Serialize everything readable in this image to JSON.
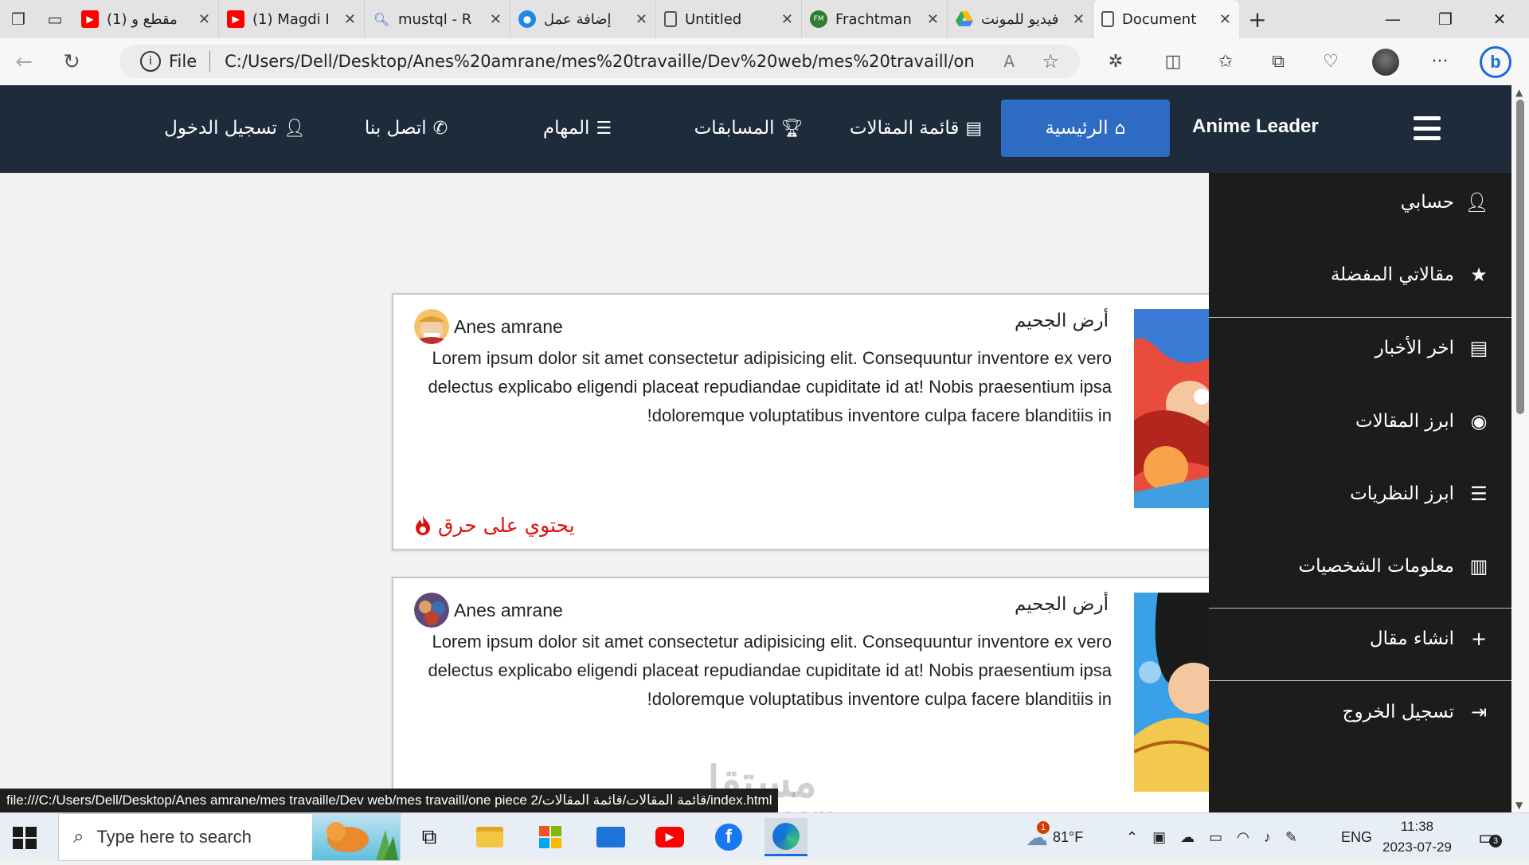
{
  "browser": {
    "tabs": [
      {
        "title": "(1) مقطع و",
        "favicon": "youtube-icon"
      },
      {
        "title": "(1) Magdi I",
        "favicon": "youtube-icon"
      },
      {
        "title": "mustql - R",
        "favicon": "search-icon"
      },
      {
        "title": "إضافة عمل",
        "favicon": "circle-icon"
      },
      {
        "title": "Untitled",
        "favicon": "page-icon"
      },
      {
        "title": "Frachtman",
        "favicon": "site-icon"
      },
      {
        "title": "فيديو للمونت",
        "favicon": "drive-icon"
      },
      {
        "title": "Document",
        "favicon": "page-icon",
        "active": true
      }
    ],
    "address_prefix": "File",
    "address": "C:/Users/Dell/Desktop/Anes%20amrane/mes%20travaille/Dev%20web/mes%20travaill/one%20piece..."
  },
  "navbar": {
    "brand": "Anime Leader",
    "items": [
      {
        "label": "الرئيسية",
        "icon": "home-icon",
        "active": true
      },
      {
        "label": "قائمة المقالات",
        "icon": "newspaper-icon"
      },
      {
        "label": "المسابقات",
        "icon": "trophy-icon"
      },
      {
        "label": "المهام",
        "icon": "tasks-icon"
      },
      {
        "label": "اتصل بنا",
        "icon": "phone-icon"
      },
      {
        "label": "تسجيل الدخول",
        "icon": "user-icon"
      }
    ]
  },
  "cards": [
    {
      "author": "Anes amrane",
      "title": "أرض الجحيم",
      "body": "Lorem ipsum dolor sit amet consectetur adipisicing elit. Consequuntur inventore ex vero delectus explicabo eligendi placeat repudiandae cupiditate id at! Nobis praesentium ipsa doloremque voluptatibus inventore culpa facere blanditiis in!",
      "warning": "يحتوي على حرق"
    },
    {
      "author": "Anes amrane",
      "title": "أرض الجحيم",
      "body": "Lorem ipsum dolor sit amet consectetur adipisicing elit. Consequuntur inventore ex vero delectus explicabo eligendi placeat repudiandae cupiditate id at! Nobis praesentium ipsa doloremque voluptatibus inventore culpa facere blanditiis in!"
    }
  ],
  "side_menu": {
    "items": [
      {
        "label": "حسابي",
        "icon": "user-icon"
      },
      {
        "label": "مقالاتي المفضلة",
        "icon": "star-icon"
      },
      {
        "label": "اخر الأخبار",
        "icon": "newspaper-icon"
      },
      {
        "label": "ابرز المقالات",
        "icon": "record-icon"
      },
      {
        "label": "ابرز النظريات",
        "icon": "list-icon"
      },
      {
        "label": "معلومات الشخصيات",
        "icon": "book-icon"
      },
      {
        "label": "انشاء مقال",
        "icon": "plus-icon"
      },
      {
        "label": "تسجيل الخروج",
        "icon": "logout-icon"
      }
    ]
  },
  "status_url": "file:///C:/Users/Dell/Desktop/Anes amrane/mes travaille/Dev web/mes travaill/one piece 2/قائمة المقالات/قائمة المقالات/index.html",
  "watermark": {
    "main": "مستقل",
    "sub": "mostaql.com"
  },
  "taskbar": {
    "search_placeholder": "Type here to search",
    "weather": "81°F",
    "weather_badge": "1",
    "language": "ENG",
    "time": "11:38",
    "date": "2023-07-29",
    "notifications": "3"
  },
  "colors": {
    "navbar_bg": "#1e2b3b",
    "nav_active": "#2e6bc3",
    "side_menu_bg": "#1c1c1c",
    "spoiler_red": "#e01010"
  }
}
